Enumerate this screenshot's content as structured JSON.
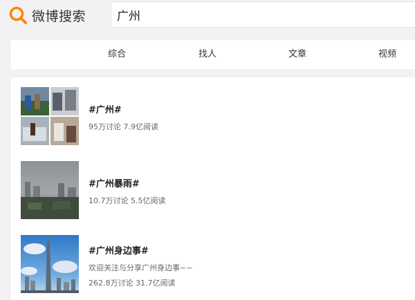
{
  "header": {
    "logo_text": "微博搜索",
    "search_value": "广州"
  },
  "tabs": [
    {
      "label": "综合"
    },
    {
      "label": "找人"
    },
    {
      "label": "文章"
    },
    {
      "label": "视频"
    }
  ],
  "results": [
    {
      "title": "#广州#",
      "stats": "95万讨论 7.9亿阅读"
    },
    {
      "title": "#广州暴雨#",
      "stats": "10.7万讨论 5.5亿阅读"
    },
    {
      "title": "#广州身边事#",
      "desc": "欢迎关注与分享广州身边事~~",
      "stats": "262.8万讨论 31.7亿阅读"
    }
  ],
  "colors": {
    "accent": "#ff8200",
    "page_bg": "#f2f2f5"
  }
}
